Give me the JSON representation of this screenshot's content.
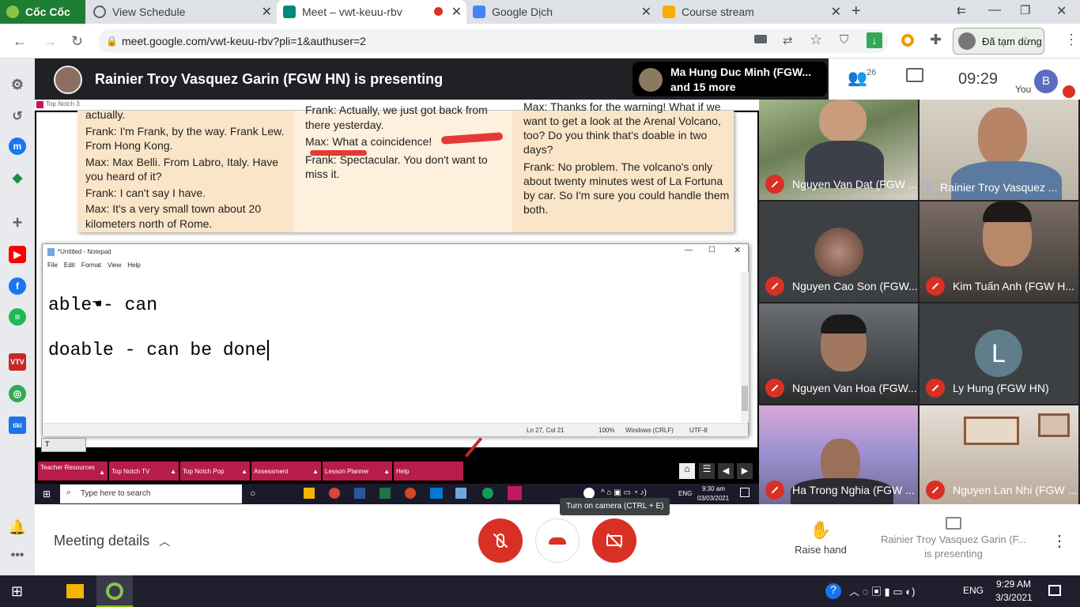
{
  "browser": {
    "tabs": [
      {
        "label": "Cốc Cốc",
        "color": "#1e8e3e"
      },
      {
        "label": "View Schedule",
        "color": "#5f6368"
      },
      {
        "label": "Meet – vwt-keuu-rbv",
        "color": "#00897b"
      },
      {
        "label": "Google Dịch",
        "color": "#4285f4"
      },
      {
        "label": "Course stream",
        "color": "#f9ab00"
      }
    ],
    "url": "meet.google.com/vwt-keuu-rbv?pli=1&authuser=2",
    "profile_label": "Đã tạm dừng"
  },
  "meet": {
    "presenter_banner": "Rainier Troy Vasquez Garin (FGW HN) is presenting",
    "participants_preview": "Ma Hung Duc Minh (FGW...",
    "participants_more": "and 15 more",
    "participant_count": "26",
    "clock": "09:29",
    "you_label": "You",
    "you_initial": "B",
    "meeting_details": "Meeting details",
    "raise_hand": "Raise hand",
    "presenting_line1": "Rainier Troy Vasquez Garin (F...",
    "presenting_line2": "is presenting",
    "camera_tooltip": "Turn on camera (CTRL + E)",
    "tiles": [
      {
        "name": "Nguyen Van Dat (FGW ...",
        "muted": true
      },
      {
        "name": "Rainier Troy Vasquez ...",
        "muted": false
      },
      {
        "name": "Nguyen Cao Son (FGW...",
        "muted": true
      },
      {
        "name": "Kim Tuấn Anh (FGW H...",
        "muted": true
      },
      {
        "name": "Nguyen Van Hoa (FGW...",
        "muted": true
      },
      {
        "name": "Ly Hung (FGW HN)",
        "muted": true,
        "initial": "L"
      },
      {
        "name": "Ha Trong Nghia (FGW ...",
        "muted": true
      },
      {
        "name": "Nguyen Lan Nhi (FGW ...",
        "muted": true
      }
    ]
  },
  "shared": {
    "app_title": "Top Notch 3",
    "book": {
      "col1": [
        "actually.",
        "Frank: I'm Frank, by the way. Frank Lew. From Hong Kong.",
        "Max: Max Belli. From Labro, Italy. Have you heard of it?",
        "Frank: I can't say I have.",
        "Max: It's a very small town about 20 kilometers north of Rome."
      ],
      "col2": [
        "Frank: Actually, we just got back from there yesterday.",
        "Max: What a coincidence!",
        "Frank: Spectacular. You don't want to miss it."
      ],
      "col3": [
        "Max: Thanks for the warning! What if we want to get a look at the Arenal Volcano, too? Do you think that's doable in two days?",
        "Frank: No problem. The volcano's only about twenty minutes west of La Fortuna by car. So I'm sure you could handle them both."
      ]
    },
    "notepad": {
      "title": "*Untitled - Notepad",
      "menu": [
        "File",
        "Edit",
        "Format",
        "View",
        "Help"
      ],
      "line1": "able - can",
      "line2": "doable - can be done",
      "status_pos": "Ln 27, Col 21",
      "status_zoom": "100%",
      "status_eol": "Windows (CRLF)",
      "status_enc": "UTF-8"
    },
    "tn_buttons": [
      "Teacher Resources",
      "Top Notch TV",
      "Top Notch Pop",
      "Assessment",
      "Lesson Planner",
      "Help"
    ],
    "inner_search": "Type here to search",
    "inner_time": "9:30 am",
    "inner_date": "03/03/2021",
    "inner_lang": "ENG"
  },
  "taskbar": {
    "lang": "ENG",
    "time": "9:29 AM",
    "date": "3/3/2021"
  }
}
